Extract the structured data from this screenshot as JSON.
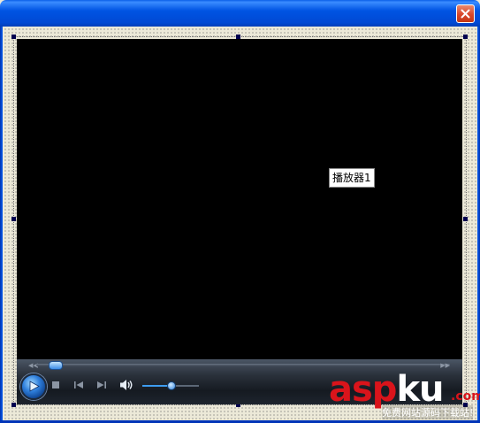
{
  "window": {
    "title": "",
    "colors": {
      "titlebar": "#0054e3",
      "close_button": "#d9462a",
      "surface": "#ece9d8"
    }
  },
  "player": {
    "control_label": "播放器1",
    "seek_position": 0.03,
    "volume_level": 0.5,
    "controls": [
      "play-icon",
      "stop-icon",
      "previous-icon",
      "next-icon",
      "volume-icon"
    ],
    "colors": {
      "accent": "#3b8ce6",
      "background": "#000000"
    }
  },
  "watermark": {
    "part1": "asp",
    "part2": "ku",
    "suffix": ".com",
    "subtitle": "免费网站源码下载站!"
  }
}
